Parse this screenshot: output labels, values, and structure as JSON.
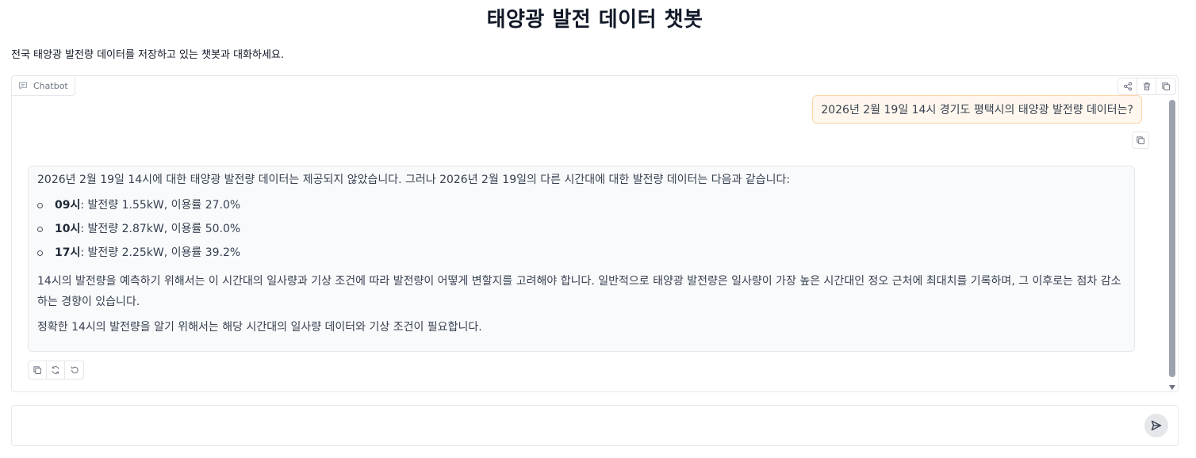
{
  "header": {
    "title": "태양광 발전 데이터 챗봇",
    "description": "전국 태양광 발전량 데이터를 저장하고 있는 챗봇과 대화하세요."
  },
  "chatbot": {
    "label": "Chatbot",
    "icons": {
      "label": "chat-bubble-icon",
      "share": "share-icon",
      "clear": "trash-icon",
      "copy_all": "copy-icon"
    },
    "messages": {
      "user": "2026년 2월 19일 14시 경기도 평택시의 태양광 발전량 데이터는?",
      "bot": {
        "intro": "2026년 2월 19일 14시에 대한 태양광 발전량 데이터는 제공되지 않았습니다. 그러나 2026년 2월 19일의 다른 시간대에 대한 발전량 데이터는 다음과 같습니다:",
        "items": [
          {
            "hour": "09시",
            "detail": ": 발전량 1.55kW, 이용률 27.0%"
          },
          {
            "hour": "10시",
            "detail": ": 발전량 2.87kW, 이용률 50.0%"
          },
          {
            "hour": "17시",
            "detail": ": 발전량 2.25kW, 이용률 39.2%"
          }
        ],
        "paragraph1": "14시의 발전량을 예측하기 위해서는 이 시간대의 일사량과 기상 조건에 따라 발전량이 어떻게 변할지를 고려해야 합니다. 일반적으로 태양광 발전량은 일사량이 가장 높은 시간대인 정오 근처에 최대치를 기록하며, 그 이후로는 점차 감소하는 경향이 있습니다.",
        "paragraph2": "정확한 14시의 발전량을 알기 위해서는 해당 시간대의 일사량 데이터와 기상 조건이 필요합니다."
      }
    },
    "bot_action_icons": [
      "copy-icon",
      "retry-icon",
      "undo-icon"
    ]
  },
  "input": {
    "placeholder": "",
    "value": "",
    "send_icon": "send-icon"
  }
}
